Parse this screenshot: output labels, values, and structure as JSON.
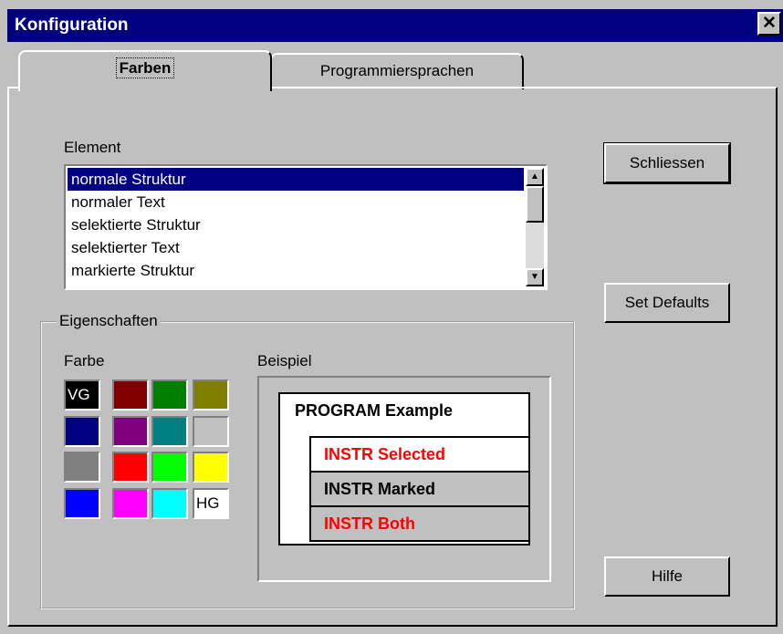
{
  "window": {
    "title": "Konfiguration",
    "close_label": "✕"
  },
  "tabs": [
    {
      "label": "Farben",
      "active": true
    },
    {
      "label": "Programmiersprachen",
      "active": false
    }
  ],
  "element": {
    "label": "Element",
    "items": [
      "normale Struktur",
      "normaler Text",
      "selektierte Struktur",
      "selektierter Text",
      "markierte Struktur"
    ],
    "selected_index": 0
  },
  "buttons": {
    "close": "Schliessen",
    "defaults": "Set Defaults",
    "help": "Hilfe"
  },
  "properties": {
    "group_label": "Eigenschaften",
    "color_label": "Farbe",
    "colors": [
      {
        "color": "#000000",
        "text": "VG",
        "text_color": "#ffffff"
      },
      {
        "color": "#800000",
        "text": ""
      },
      {
        "color": "#008000",
        "text": ""
      },
      {
        "color": "#808000",
        "text": ""
      },
      {
        "color": "#000080",
        "text": ""
      },
      {
        "color": "#800080",
        "text": ""
      },
      {
        "color": "#008080",
        "text": ""
      },
      {
        "color": "#c0c0c0",
        "text": ""
      },
      {
        "color": "#808080",
        "text": ""
      },
      {
        "color": "#ff0000",
        "text": ""
      },
      {
        "color": "#00ff00",
        "text": ""
      },
      {
        "color": "#ffff00",
        "text": ""
      },
      {
        "color": "#0000ff",
        "text": ""
      },
      {
        "color": "#ff00ff",
        "text": ""
      },
      {
        "color": "#00ffff",
        "text": ""
      },
      {
        "color": "#ffffff",
        "text": "HG",
        "text_color": "#000000"
      }
    ],
    "example_label": "Beispiel",
    "example": {
      "program": "PROGRAM Example",
      "rows": [
        {
          "text": "INSTR Selected",
          "color": "#ff0000",
          "bg": "#ffffff"
        },
        {
          "text": "INSTR Marked",
          "color": "#000000",
          "bg": "#c0c0c0"
        },
        {
          "text": "INSTR Both",
          "color": "#ff0000",
          "bg": "#c0c0c0"
        }
      ]
    }
  }
}
